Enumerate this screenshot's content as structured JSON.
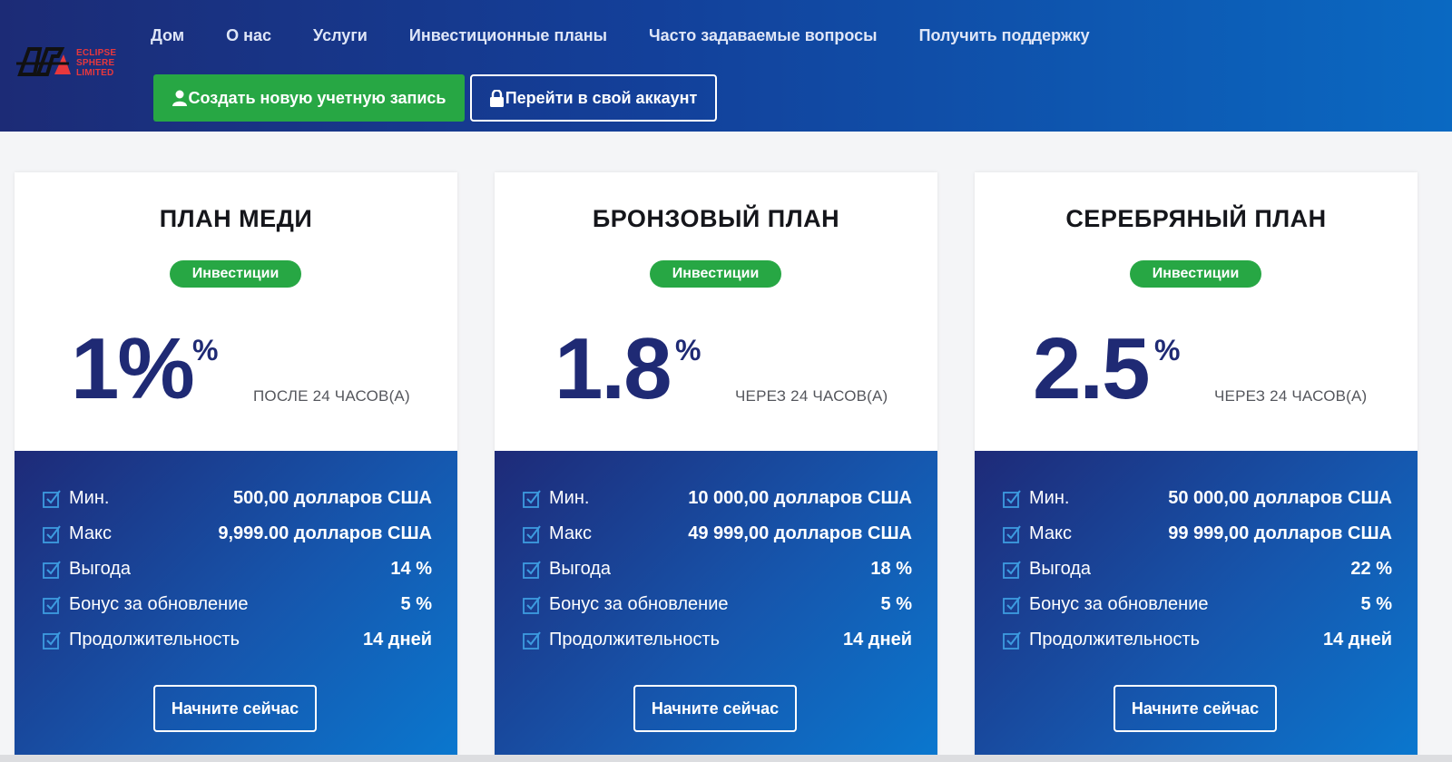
{
  "logo": {
    "lines": [
      "ECLIPSE",
      "SPHERE",
      "LIMITED"
    ],
    "colors": {
      "mark": "#111111",
      "accent": "#e8383d"
    }
  },
  "nav": {
    "items": [
      {
        "label": "Дом"
      },
      {
        "label": "О нас"
      },
      {
        "label": "Услуги"
      },
      {
        "label": "Инвестиционные планы"
      },
      {
        "label": "Часто задаваемые вопросы"
      },
      {
        "label": "Получить поддержку"
      }
    ]
  },
  "header": {
    "create_account_label": "Создать новую учетную запись",
    "create_account_icon": "user-icon",
    "login_label": "Перейти в свой аккаунт",
    "login_icon": "lock-icon"
  },
  "colors": {
    "header_start": "#1c2b76",
    "header_end": "#0a69c2",
    "green": "#27a744",
    "rate_blue": "#1f2a74"
  },
  "plans": [
    {
      "title": "ПЛАН МЕДИ",
      "badge": "Инвестиции",
      "rate": "1%",
      "rate_suffix": "%",
      "period": "ПОСЛЕ 24 ЧАСОВ(А)",
      "rows": [
        {
          "label": "Мин.",
          "value": "500,00 долларов США"
        },
        {
          "label": "Макс",
          "value": "9,999.00 долларов США"
        },
        {
          "label": "Выгода",
          "value": "14 %"
        },
        {
          "label": "Бонус за обновление",
          "value": "5 %"
        },
        {
          "label": "Продолжительность",
          "value": "14 дней"
        }
      ],
      "button": "Начните сейчас"
    },
    {
      "title": "БРОНЗОВЫЙ ПЛАН",
      "badge": "Инвестиции",
      "rate": "1.8",
      "rate_suffix": "%",
      "period": "ЧЕРЕЗ 24 ЧАСОВ(А)",
      "rows": [
        {
          "label": "Мин.",
          "value": "10 000,00 долларов США"
        },
        {
          "label": "Макс",
          "value": "49 999,00 долларов США"
        },
        {
          "label": "Выгода",
          "value": "18 %"
        },
        {
          "label": "Бонус за обновление",
          "value": "5 %"
        },
        {
          "label": "Продолжительность",
          "value": "14 дней"
        }
      ],
      "button": "Начните сейчас"
    },
    {
      "title": "СЕРЕБРЯНЫЙ ПЛАН",
      "badge": "Инвестиции",
      "rate": "2.5",
      "rate_suffix": "%",
      "period": "ЧЕРЕЗ 24 ЧАСОВ(А)",
      "rows": [
        {
          "label": "Мин.",
          "value": "50 000,00 долларов США"
        },
        {
          "label": "Макс",
          "value": "99 999,00 долларов США"
        },
        {
          "label": "Выгода",
          "value": "22 %"
        },
        {
          "label": "Бонус за обновление",
          "value": "5 %"
        },
        {
          "label": "Продолжительность",
          "value": "14 дней"
        }
      ],
      "button": "Начните сейчас"
    }
  ]
}
